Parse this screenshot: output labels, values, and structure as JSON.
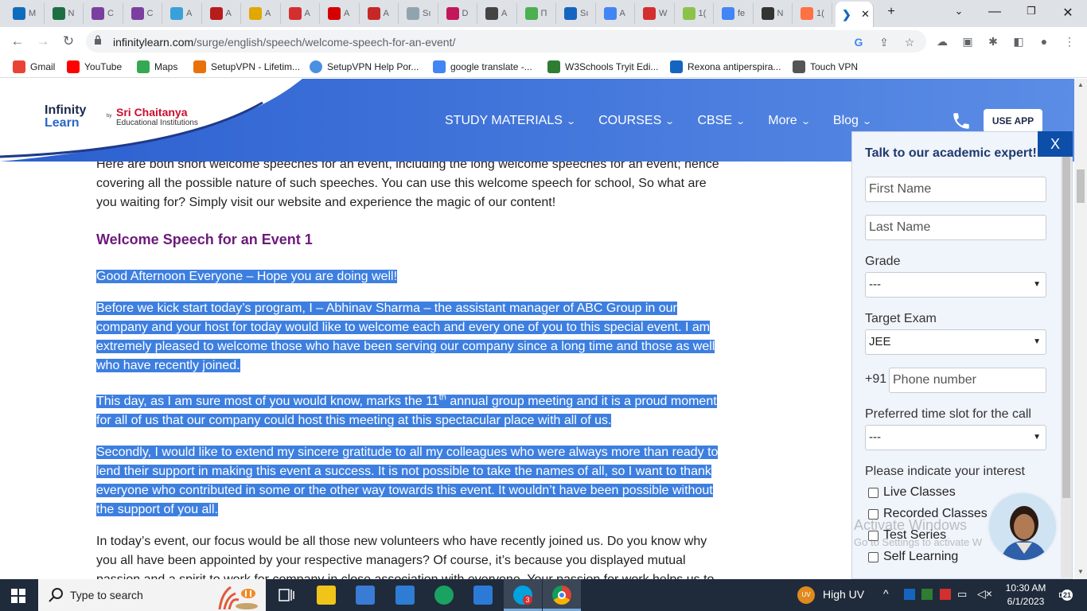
{
  "browser": {
    "tabs": [
      {
        "label": "M",
        "icon": "outlook-icon",
        "color": "#0f6cbd"
      },
      {
        "label": "N",
        "icon": "excel-icon",
        "color": "#1d6f42"
      },
      {
        "label": "C",
        "icon": "w-icon",
        "color": "#7b3fa0"
      },
      {
        "label": "C",
        "icon": "w-icon",
        "color": "#7b3fa0"
      },
      {
        "label": "A",
        "icon": "z-icon",
        "color": "#3aa0d8"
      },
      {
        "label": "A",
        "icon": "circle-icon",
        "color": "#b71c1c"
      },
      {
        "label": "A",
        "icon": "b-icon",
        "color": "#e0a800"
      },
      {
        "label": "A",
        "icon": "lifebuoy-icon",
        "color": "#d32f2f"
      },
      {
        "label": "A",
        "icon": "flag-icon",
        "color": "#d50000"
      },
      {
        "label": "A",
        "icon": "calendar-icon",
        "color": "#c62828"
      },
      {
        "label": "Sı",
        "icon": "img-icon",
        "color": "#90a4ae"
      },
      {
        "label": "D",
        "icon": "hc-icon",
        "color": "#c2185b"
      },
      {
        "label": "A",
        "icon": "globe-icon",
        "color": "#444"
      },
      {
        "label": "П",
        "icon": "leaf-icon",
        "color": "#4caf50"
      },
      {
        "label": "Sı",
        "icon": "check-icon",
        "color": "#1565c0"
      },
      {
        "label": "A",
        "icon": "google-icon",
        "color": "#4285f4"
      },
      {
        "label": "W",
        "icon": "img-icon",
        "color": "#d32f2f"
      },
      {
        "label": "1(",
        "icon": "bulb-icon",
        "color": "#8bc34a"
      },
      {
        "label": "fe",
        "icon": "google-icon",
        "color": "#4285f4"
      },
      {
        "label": "N",
        "icon": "github-icon",
        "color": "#333"
      },
      {
        "label": "1(",
        "icon": "fire-icon",
        "color": "#ff7043"
      }
    ],
    "active_tab_icon": "chevron-icon",
    "url_host": "infinitylearn.com",
    "url_path": "/surge/english/speech/welcome-speech-for-an-event/",
    "bookmarks": [
      {
        "label": "Gmail",
        "icon": "google-icon"
      },
      {
        "label": "YouTube",
        "icon": "youtube-icon"
      },
      {
        "label": "Maps",
        "icon": "maps-icon"
      },
      {
        "label": "SetupVPN - Lifetim...",
        "icon": "vpn-icon"
      },
      {
        "label": "SetupVPN Help Por...",
        "icon": "circle-icon"
      },
      {
        "label": "google translate -...",
        "icon": "google-icon"
      },
      {
        "label": "W3Schools Tryit Edi...",
        "icon": "w3-icon"
      },
      {
        "label": "Rexona antiperspira...",
        "icon": "rexona-icon"
      },
      {
        "label": "Touch VPN",
        "icon": "touch-icon"
      }
    ]
  },
  "site": {
    "logo_infinity": "Infinity",
    "logo_learn": "Learn",
    "logo_by": "by",
    "logo_brand": "Sri Chaitanya",
    "logo_sub": "Educational Institutions",
    "nav": [
      "STUDY MATERIALS",
      "COURSES",
      "CBSE",
      "More",
      "Blog"
    ],
    "use_app": "USE APP"
  },
  "article": {
    "intro": "Here are both short welcome speeches for an event, including the long welcome speeches for an event; hence covering all the possible nature of such speeches. You can use this welcome speech for school, So what are you waiting for? Simply visit our website and experience the magic of our content!",
    "heading": "Welcome Speech for an Event 1",
    "p1": "Good Afternoon Everyone – Hope you are doing well!",
    "p2": "Before we kick start today’s program, I – Abhinav Sharma – the assistant manager of ABC Group in our company and your host for today would like to welcome each and every one of you to this special event. I am extremely pleased to welcome those who have been serving our company since a long time and those as well who have recently joined.",
    "p3_a": "This day, as I am sure most of you would know, marks the 11",
    "p3_sup": "th",
    "p3_b": " annual group meeting and it is a proud moment for all of us that our company could host this meeting at this spectacular place with all of us.",
    "p4": "Secondly, I would like to extend my sincere gratitude to all my colleagues who were always more than ready to lend their support in making this event a success. It is not possible to take the names of all, so I want to thank everyone who contributed in some or the other way towards this event. It wouldn’t have been possible without the support of you all.",
    "p5": "In today’s event, our focus would be all those new volunteers who have recently joined us. Do you know why you all have been appointed by your respective managers? Of course, it’s because you displayed mutual passion and a spirit to work for company in close association with everyone. Your passion for work helps us to"
  },
  "form": {
    "close": "X",
    "title": "Talk to our academic expert!",
    "first_name_placeholder": "First Name",
    "last_name_placeholder": "Last Name",
    "grade_label": "Grade",
    "grade_value": "---",
    "target_label": "Target Exam",
    "target_value": "JEE",
    "country_code": "+91",
    "phone_placeholder": "Phone number",
    "slot_label": "Preferred time slot for the call",
    "slot_value": "---",
    "interest_label": "Please indicate your interest",
    "interests": [
      "Live Classes",
      "Recorded Classes",
      "Test Series",
      "Self Learning"
    ],
    "watermark_1": "Activate Windows",
    "watermark_2": "Go to Settings to activate W"
  },
  "taskbar": {
    "search_placeholder": "Type to search",
    "weather": "High UV",
    "weather_badge": "UV",
    "time": "10:30 AM",
    "date": "6/1/2023",
    "notifications": "21",
    "skype_badge": "3"
  }
}
